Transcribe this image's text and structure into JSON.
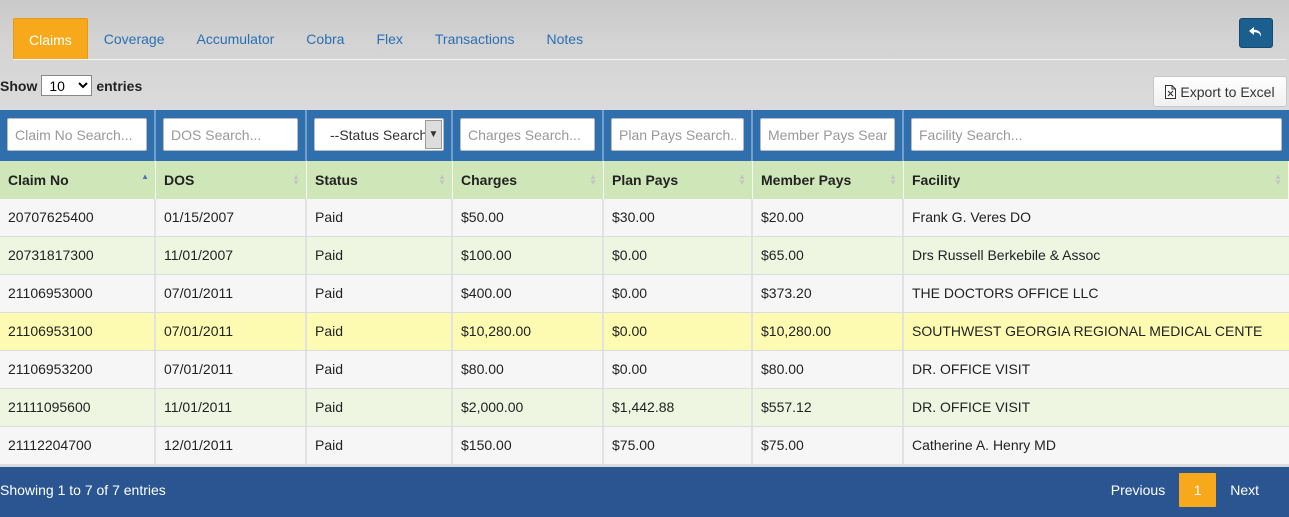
{
  "tabs": [
    "Claims",
    "Coverage",
    "Accumulator",
    "Cobra",
    "Flex",
    "Transactions",
    "Notes"
  ],
  "active_tab": "Claims",
  "length": {
    "show_label": "Show",
    "value": "10",
    "entries_label": "entries"
  },
  "export_label": "Export to Excel",
  "filters": {
    "claim_no": "Claim No Search...",
    "dos": "DOS Search...",
    "status": "--Status Search--",
    "charges": "Charges Search...",
    "plan_pays": "Plan Pays Search...",
    "member_pays": "Member Pays Search...",
    "facility": "Facility Search..."
  },
  "columns": [
    "Claim No",
    "DOS",
    "Status",
    "Charges",
    "Plan Pays",
    "Member Pays",
    "Facility"
  ],
  "rows": [
    [
      "20707625400",
      "01/15/2007",
      "Paid",
      "$50.00",
      "$30.00",
      "$20.00",
      "Frank G. Veres DO"
    ],
    [
      "20731817300",
      "11/01/2007",
      "Paid",
      "$100.00",
      "$0.00",
      "$65.00",
      "Drs Russell Berkebile & Assoc"
    ],
    [
      "21106953000",
      "07/01/2011",
      "Paid",
      "$400.00",
      "$0.00",
      "$373.20",
      "THE DOCTORS OFFICE LLC"
    ],
    [
      "21106953100",
      "07/01/2011",
      "Paid",
      "$10,280.00",
      "$0.00",
      "$10,280.00",
      "SOUTHWEST GEORGIA REGIONAL MEDICAL CENTE"
    ],
    [
      "21106953200",
      "07/01/2011",
      "Paid",
      "$80.00",
      "$0.00",
      "$80.00",
      "DR. OFFICE VISIT"
    ],
    [
      "21111095600",
      "11/01/2011",
      "Paid",
      "$2,000.00",
      "$1,442.88",
      "$557.12",
      "DR. OFFICE VISIT"
    ],
    [
      "21112204700",
      "12/01/2011",
      "Paid",
      "$150.00",
      "$75.00",
      "$75.00",
      "Catherine A. Henry MD"
    ]
  ],
  "footer": {
    "info": "Showing 1 to 7 of 7 entries",
    "previous": "Previous",
    "page": "1",
    "next": "Next"
  },
  "colors": {
    "accent": "#f7a81b",
    "header_blue": "#2f6fae",
    "footer_blue": "#2a5591",
    "head_green": "#cfe6b8",
    "highlight": "#fdfbb2"
  }
}
